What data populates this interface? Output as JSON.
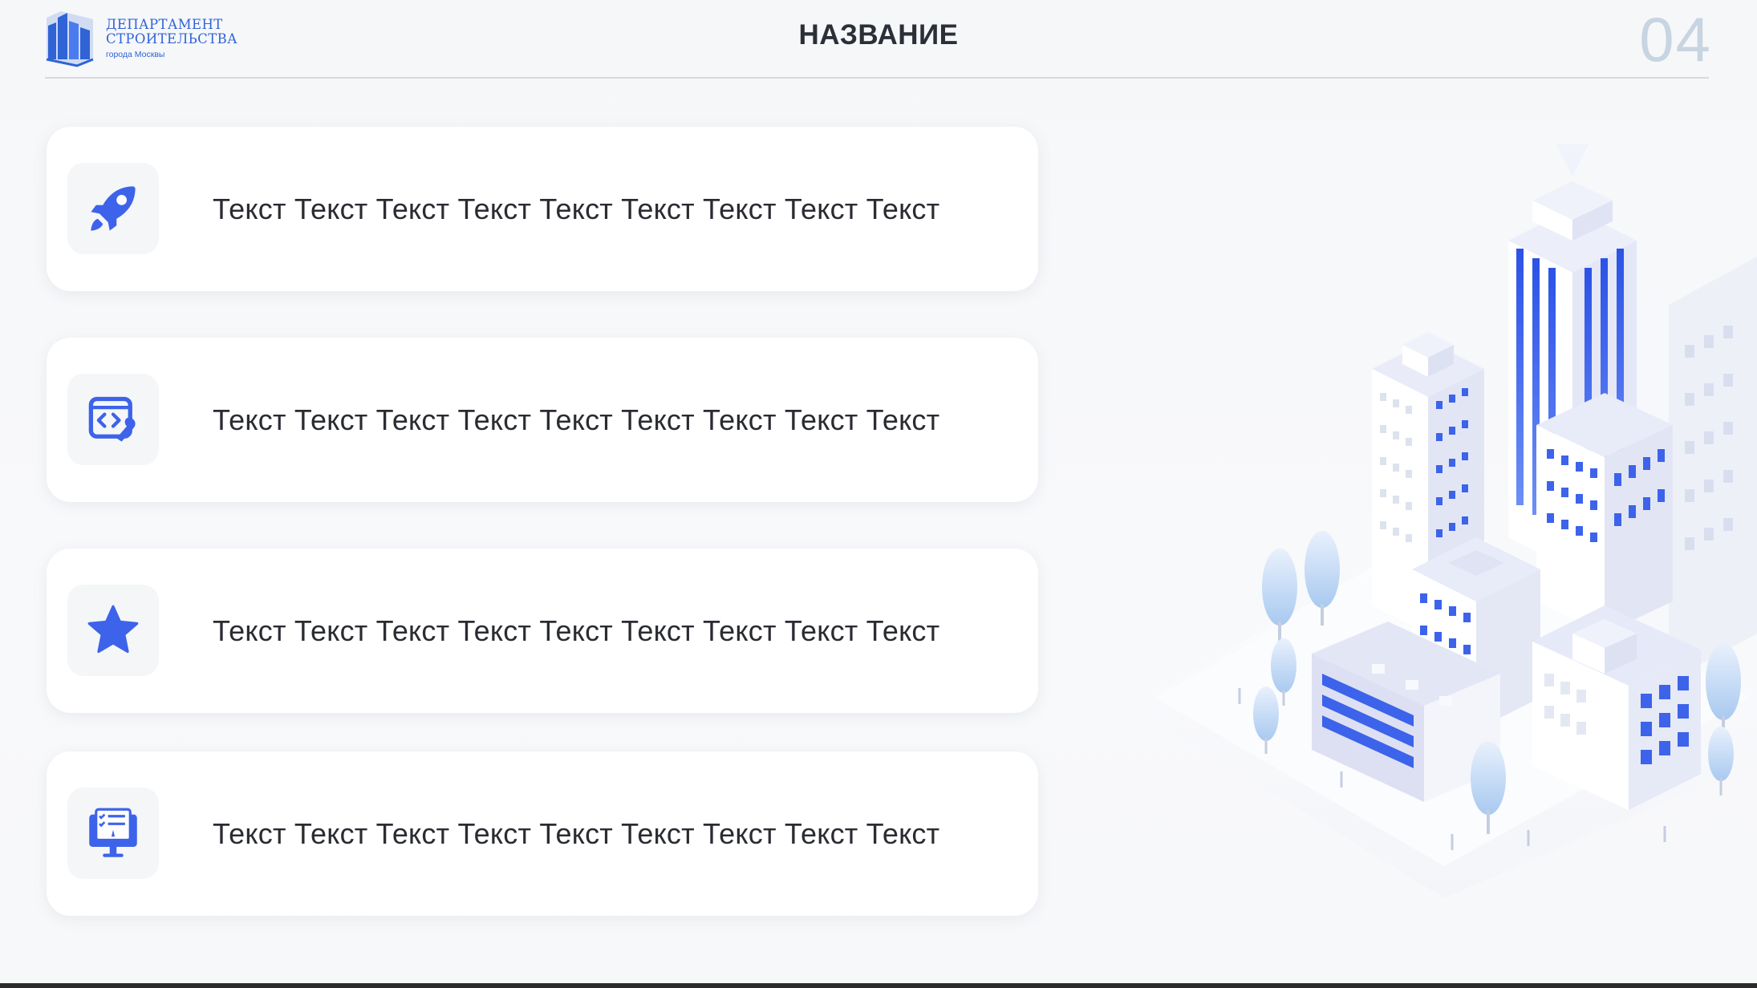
{
  "header": {
    "logo": {
      "line1": "ДЕПАРТАМЕНТ",
      "line2": "СТРОИТЕЛЬСТВА",
      "line3": "города Москвы"
    },
    "title": "НАЗВАНИЕ",
    "page_number": "04"
  },
  "cards": [
    {
      "icon": "rocket-icon",
      "text": "Текст Текст Текст Текст Текст Текст Текст Текст Текст"
    },
    {
      "icon": "code-settings-icon",
      "text": "Текст Текст Текст Текст Текст Текст Текст Текст Текст"
    },
    {
      "icon": "star-icon",
      "text": "Текст Текст Текст Текст Текст Текст Текст Текст Текст"
    },
    {
      "icon": "monitor-checklist-icon",
      "text": "Текст Текст Текст Текст Текст Текст Текст Текст Текст"
    }
  ],
  "colors": {
    "accent": "#2f63d6",
    "icon_blue": "#3d63ea",
    "title": "#2b2f38",
    "page_number": "#c7d4e1",
    "card_bg": "#ffffff",
    "slide_bg": "#f6f7f9"
  }
}
